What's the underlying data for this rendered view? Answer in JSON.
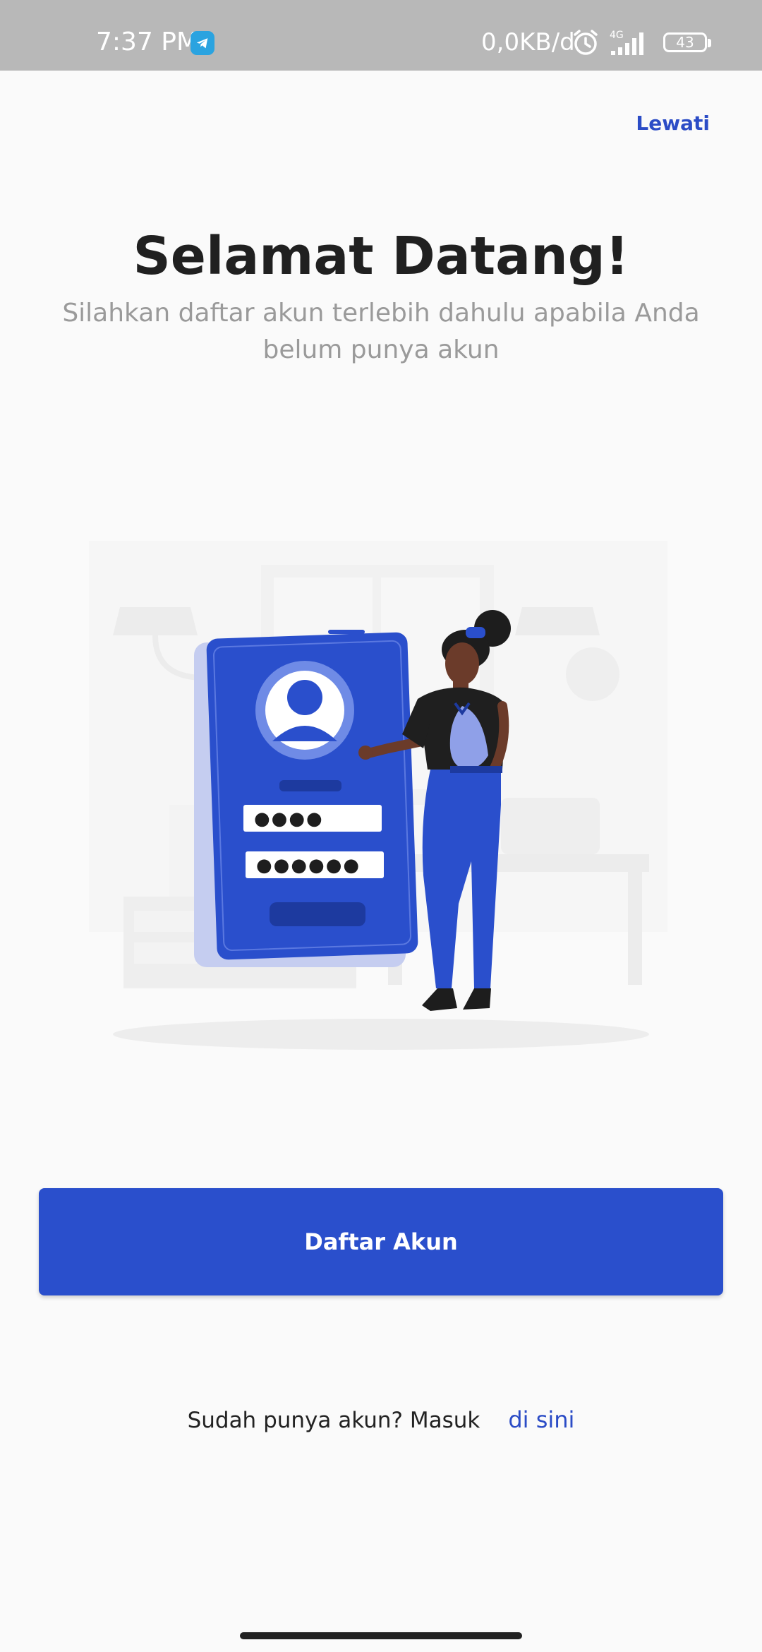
{
  "status_bar": {
    "time": "7:37 PM",
    "network_speed": "0,0KB/d",
    "network_type": "4G",
    "battery_level": "43",
    "icons": [
      "telegram-icon",
      "alarm-icon",
      "signal-icon",
      "battery-icon"
    ]
  },
  "header": {
    "skip_label": "Lewati",
    "title": "Selamat Datang!",
    "subtitle": "Silahkan daftar akun terlebih dahulu apabila Anda belum punya akun"
  },
  "illustration": {
    "password_dots_1": "●●●●",
    "password_dots_2": "●●●●●●"
  },
  "actions": {
    "register_label": "Daftar Akun",
    "login_prompt": "Sudah punya akun? Masuk",
    "login_link": "di sini"
  },
  "colors": {
    "primary": "#2a4fcc",
    "link": "#2b4cc6",
    "title": "#202020",
    "subtitle": "#9a9a9a",
    "status_bar": "#b8b8b8",
    "background": "#fafafa"
  }
}
